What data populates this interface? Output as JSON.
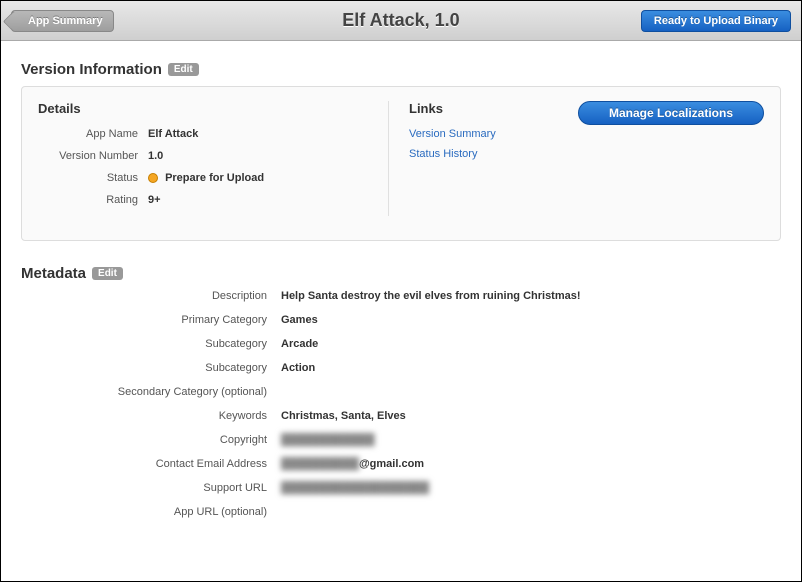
{
  "header": {
    "back_label": "App Summary",
    "title": "Elf Attack, 1.0",
    "upload_label": "Ready to Upload Binary"
  },
  "version_info": {
    "heading": "Version Information",
    "edit_label": "Edit",
    "details_heading": "Details",
    "links_heading": "Links",
    "app_name_label": "App Name",
    "app_name_value": "Elf Attack",
    "version_label": "Version Number",
    "version_value": "1.0",
    "status_label": "Status",
    "status_value": "Prepare for Upload",
    "rating_label": "Rating",
    "rating_value": "9+",
    "link_version_summary": "Version Summary",
    "link_status_history": "Status History",
    "manage_localizations": "Manage Localizations"
  },
  "metadata": {
    "heading": "Metadata",
    "edit_label": "Edit",
    "description_label": "Description",
    "description_value": "Help Santa destroy the evil elves from ruining Christmas!",
    "primary_category_label": "Primary Category",
    "primary_category_value": "Games",
    "subcategory1_label": "Subcategory",
    "subcategory1_value": "Arcade",
    "subcategory2_label": "Subcategory",
    "subcategory2_value": "Action",
    "secondary_category_label": "Secondary Category (optional)",
    "secondary_category_value": "",
    "keywords_label": "Keywords",
    "keywords_value": "Christmas, Santa, Elves",
    "copyright_label": "Copyright",
    "copyright_value": "████████████",
    "contact_email_label": "Contact Email Address",
    "contact_email_prefix": "██████████",
    "contact_email_suffix": "@gmail.com",
    "support_url_label": "Support URL",
    "support_url_value": "███████████████████",
    "app_url_label": "App URL (optional)",
    "app_url_value": ""
  }
}
